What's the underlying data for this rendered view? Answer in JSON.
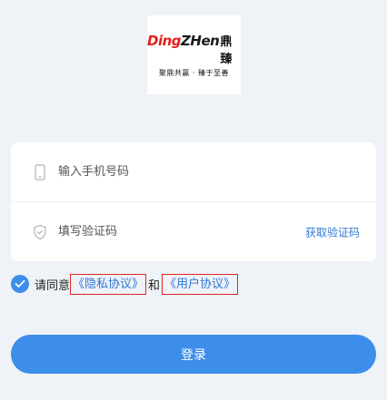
{
  "logo": {
    "brand_red": "Ding",
    "brand_dark": "ZHen",
    "brand_cn": "鼎臻",
    "slogan": "聚鼎共赢 · 臻于至善"
  },
  "form": {
    "phone_placeholder": "输入手机号码",
    "code_placeholder": "填写验证码",
    "get_code_label": "获取验证码"
  },
  "agreement": {
    "prefix": "请同意",
    "privacy_link": "《隐私协议》",
    "and": "和",
    "user_link": "《用户协议》",
    "checked": true
  },
  "login_label": "登录",
  "colors": {
    "accent": "#3d8eeb",
    "link": "#2f78d8",
    "highlight_border": "#d92a20",
    "logo_red": "#e0201b"
  },
  "icons": {
    "phone": "phone-icon",
    "shield": "shield-icon",
    "check": "checkmark-icon"
  }
}
